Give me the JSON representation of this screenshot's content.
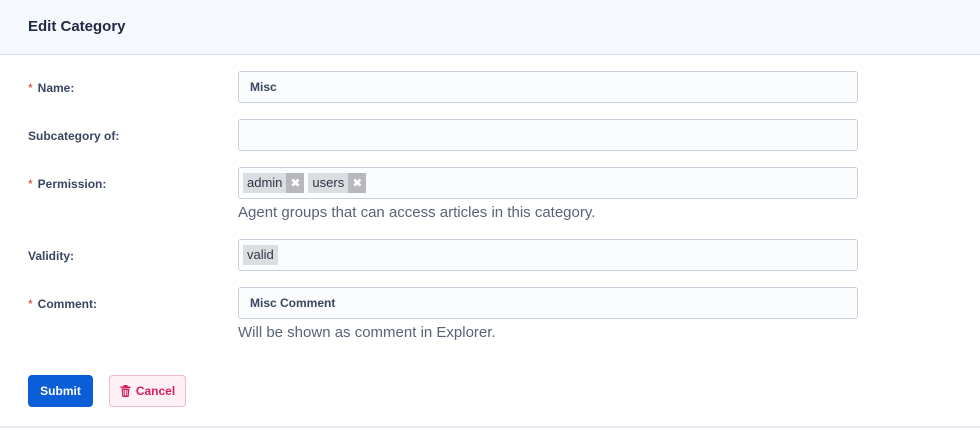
{
  "header": {
    "title": "Edit Category"
  },
  "form": {
    "name": {
      "label": "Name:",
      "required_mark": "*",
      "value": "Misc"
    },
    "subcategory": {
      "label": "Subcategory of:",
      "value": ""
    },
    "permission": {
      "label": "Permission:",
      "required_mark": "*",
      "tags": [
        "admin",
        "users"
      ],
      "remove_glyph": "✖",
      "help": "Agent groups that can access articles in this category."
    },
    "validity": {
      "label": "Validity:",
      "tags": [
        "valid"
      ]
    },
    "comment": {
      "label": "Comment:",
      "required_mark": "*",
      "value": "Misc Comment",
      "help": "Will be shown as comment in Explorer."
    }
  },
  "actions": {
    "submit_label": "Submit",
    "cancel_label": "Cancel",
    "cancel_icon": "trash-icon"
  },
  "colors": {
    "primary": "#0a5fd8",
    "danger": "#d81f57",
    "required": "#d9312b"
  }
}
